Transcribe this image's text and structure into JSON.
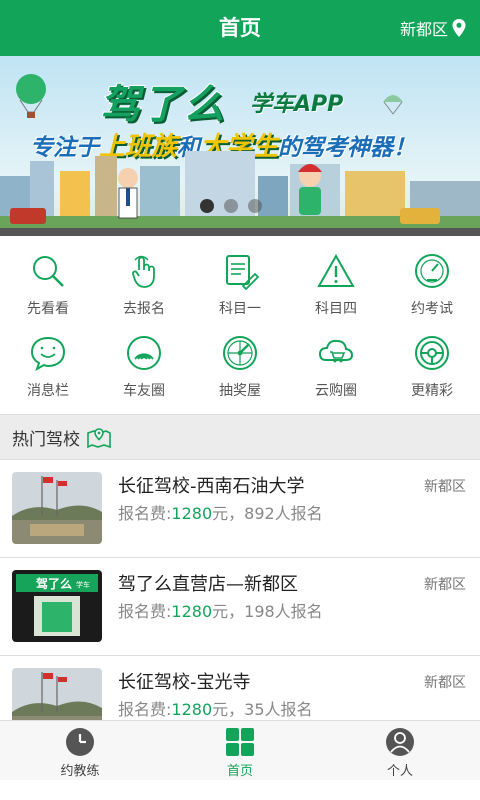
{
  "header": {
    "title": "首页",
    "city": "新都区"
  },
  "banner": {
    "brand": "驾了么",
    "brand_sub": "学车APP",
    "slogan_prefix": "专注于",
    "slogan_hl1": "上班族",
    "slogan_mid": "和",
    "slogan_hl2": "大学生",
    "slogan_suffix": "的驾考神器！",
    "slides": 3,
    "active_slide": 1
  },
  "menu": [
    {
      "label": "先看看",
      "icon": "magnifier-icon"
    },
    {
      "label": "去报名",
      "icon": "tap-hand-icon"
    },
    {
      "label": "科目一",
      "icon": "document-pen-icon"
    },
    {
      "label": "科目四",
      "icon": "warning-triangle-icon"
    },
    {
      "label": "约考试",
      "icon": "gauge-icon"
    },
    {
      "label": "消息栏",
      "icon": "chat-smile-icon"
    },
    {
      "label": "车友圈",
      "icon": "signal-rings-icon"
    },
    {
      "label": "抽奖屋",
      "icon": "lottery-wheel-icon"
    },
    {
      "label": "云购圈",
      "icon": "cloud-cart-icon"
    },
    {
      "label": "更精彩",
      "icon": "steering-wheel-icon"
    }
  ],
  "section": {
    "title": "热门驾校",
    "icon": "map-pin-icon"
  },
  "schools": [
    {
      "name": "长征驾校-西南石油大学",
      "area": "新都区",
      "fee_label": "报名费:",
      "fee": "1280",
      "fee_unit": "元，",
      "count_text": "892人报名"
    },
    {
      "name": "驾了么直营店—新都区",
      "area": "新都区",
      "fee_label": "报名费:",
      "fee": "1280",
      "fee_unit": "元，",
      "count_text": "198人报名"
    },
    {
      "name": "长征驾校-宝光寺",
      "area": "新都区",
      "fee_label": "报名费:",
      "fee": "1280",
      "fee_unit": "元，",
      "count_text": "35人报名"
    }
  ],
  "store_sign": {
    "main": "驾了么",
    "sub": "学车"
  },
  "tabs": [
    {
      "label": "约教练",
      "icon": "clock-icon",
      "active": false
    },
    {
      "label": "首页",
      "icon": "grid-home-icon",
      "active": true
    },
    {
      "label": "个人",
      "icon": "person-icon",
      "active": false
    }
  ],
  "colors": {
    "primary": "#12a55a",
    "text": "#222222",
    "muted": "#888888"
  }
}
